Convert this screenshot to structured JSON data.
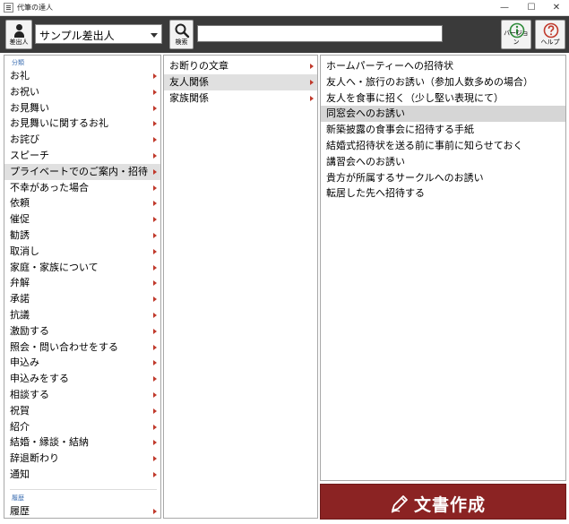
{
  "window": {
    "title": "代筆の達人",
    "min_glyph": "—",
    "max_glyph": "☐",
    "close_glyph": "✕"
  },
  "toolbar": {
    "sender_label": "差出人",
    "sender_value": "サンプル差出人",
    "search_label": "検索",
    "search_value": "",
    "version_label": "バージョン",
    "help_label": "ヘルプ"
  },
  "categories": {
    "section_label": "分類",
    "items": [
      {
        "label": "お礼"
      },
      {
        "label": "お祝い"
      },
      {
        "label": "お見舞い"
      },
      {
        "label": "お見舞いに関するお礼"
      },
      {
        "label": "お詫び"
      },
      {
        "label": "スピーチ"
      },
      {
        "label": "プライベートでのご案内・招待"
      },
      {
        "label": "不幸があった場合"
      },
      {
        "label": "依頼"
      },
      {
        "label": "催促"
      },
      {
        "label": "勧誘"
      },
      {
        "label": "取消し"
      },
      {
        "label": "家庭・家族について"
      },
      {
        "label": "弁解"
      },
      {
        "label": "承諾"
      },
      {
        "label": "抗議"
      },
      {
        "label": "激励する"
      },
      {
        "label": "照会・問い合わせをする"
      },
      {
        "label": "申込み"
      },
      {
        "label": "申込みをする"
      },
      {
        "label": "相談する"
      },
      {
        "label": "祝賀"
      },
      {
        "label": "紹介"
      },
      {
        "label": "結婚・縁談・結納"
      },
      {
        "label": "辞退断わり"
      },
      {
        "label": "通知"
      }
    ],
    "selected_index": 6,
    "history_section_label": "履歴",
    "history_item": "履歴"
  },
  "subcategories": {
    "items": [
      {
        "label": "お断りの文章"
      },
      {
        "label": "友人関係"
      },
      {
        "label": "家族関係"
      }
    ],
    "selected_index": 1
  },
  "letters": {
    "items": [
      "ホームパーティーへの招待状",
      "友人へ・旅行のお誘い（参加人数多めの場合）",
      "友人を食事に招く（少し堅い表現にて）",
      "同窓会へのお誘い",
      "新築披露の食事会に招待する手紙",
      "結婚式招待状を送る前に事前に知らせておく",
      "講習会へのお誘い",
      "貴方が所属するサークルへのお誘い",
      "転居した先へ招待する"
    ],
    "selected_index": 3
  },
  "create_button": {
    "label": "文書作成"
  },
  "colors": {
    "toolbar_bg": "#3a3a3a",
    "create_button_bg": "#8b2323",
    "arrow_red": "#c0392b",
    "section_blue": "#3d6fb2"
  }
}
